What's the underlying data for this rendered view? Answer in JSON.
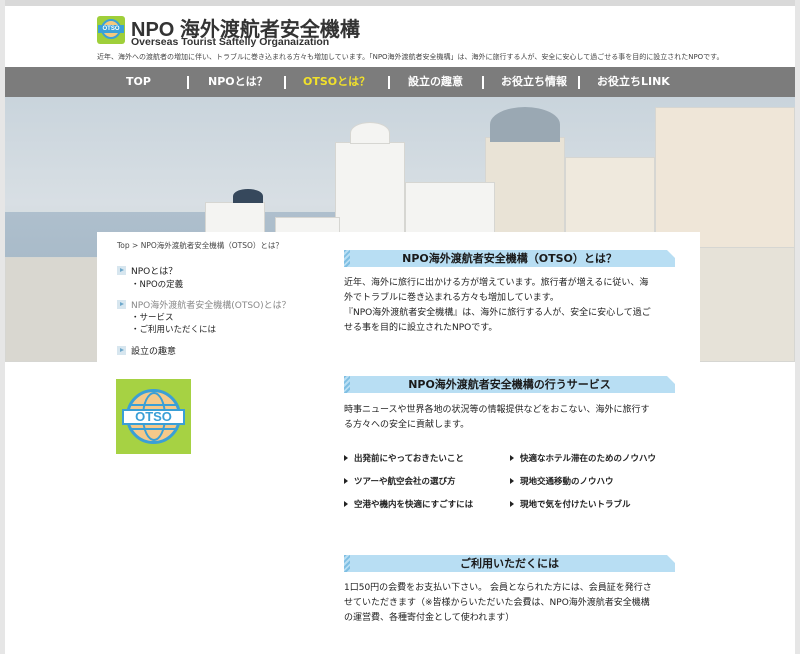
{
  "header": {
    "logo_text": "OTSO",
    "title": "NPO 海外渡航者安全機構",
    "subtitle": "Overseas Tourist  Saftelly Organaization",
    "tagline": "近年、海外への渡航者の増加に伴い、トラブルに巻き込まれる方々も増加しています。「NPO海外渡航者安全機構」は、海外に旅行する人が、安全に安心して過ごせる事を目的に設立されたNPOです。"
  },
  "nav": {
    "items": [
      {
        "label": "TOP"
      },
      {
        "label": "NPOとは？"
      },
      {
        "label": "OTSOとは？",
        "active": true
      },
      {
        "label": "設立の趣意"
      },
      {
        "label": "お役立ち情報"
      },
      {
        "label": "お役立ちLINK"
      }
    ],
    "bg_color": "#7c7c7c",
    "active_color": "#f2e22a"
  },
  "breadcrumb": "Top > NPO海外渡航者安全機構（OTSO）とは？",
  "side_menu": {
    "npo_label": "NPOとは？",
    "npo_sub": "・NPOの定義",
    "otso_label": "NPO海外渡航者安全機構(OTSO)とは？",
    "otso_sub1": "・サービス",
    "otso_sub2": "・ご利用いただくには",
    "purpose_label": "設立の趣意"
  },
  "sections": {
    "about": {
      "heading": "NPO海外渡航者安全機構（OTSO）とは？",
      "line1": "近年、海外に旅行に出かける方が増えています。旅行者が増えるに従い、海",
      "line2": "外でトラブルに巻き込まれる方々も増加しています。",
      "line3": "『NPO海外渡航者安全機構』は、海外に旅行する人が、安全に安心して過ご",
      "line4": "せる事を目的に設立されたNPOです。"
    },
    "services": {
      "heading": "NPO海外渡航者安全機構の行うサービス",
      "line1": "時事ニュースや世界各地の状況等の情報提供などをおこない、海外に旅行す",
      "line2": "る方々への安全に貢献します。",
      "items": [
        "出発前にやっておきたいこと",
        "快適なホテル滞在のためのノウハウ",
        "ツアーや航空会社の選び方",
        "現地交通移動のノウハウ",
        "空港や機内を快適にすごすには",
        "現地で気を付けたいトラブル"
      ]
    },
    "usage": {
      "heading": "ご利用いただくには",
      "line1": "1口50円の会費をお支払い下さい。 会員となられた方には、会員証を発行さ",
      "line2": "せていただきます（※皆様からいただいた会費は、NPO海外渡航者安全機構",
      "line3": "の運営費、各種寄付金として使われます）"
    }
  },
  "colors": {
    "section_heading_bg": "#b8def3",
    "logo_green": "#a6d243",
    "logo_blue": "#3a9fd6"
  }
}
